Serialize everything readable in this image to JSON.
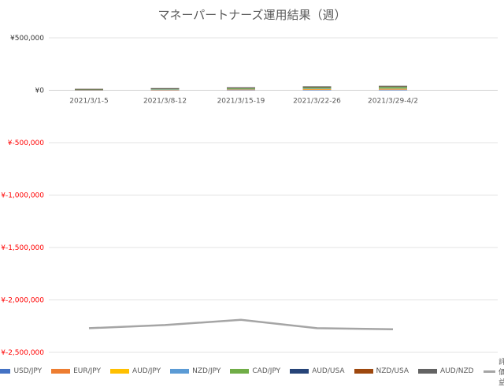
{
  "chart_data": {
    "type": "bar",
    "title": "マネーパートナーズ運用結果（週）",
    "categories": [
      "2021/3/1-5",
      "2021/3/8-12",
      "2021/3/15-19",
      "2021/3/22-26",
      "2021/3/29-4/2"
    ],
    "ylim": [
      -2500000,
      500000
    ],
    "yticks": [
      "¥500,000",
      "¥0",
      "¥-500,000",
      "¥-1,000,000",
      "¥-1,500,000",
      "¥-2,000,000",
      "¥-2,500,000"
    ],
    "ytick_values": [
      500000,
      0,
      -500000,
      -1000000,
      -1500000,
      -2000000,
      -2500000
    ],
    "stacked": true,
    "grid": true,
    "legend_position": "bottom",
    "series": [
      {
        "name": "USD/JPY",
        "color": "#4472c4",
        "values": [
          1500,
          3000,
          4000,
          5000,
          6000
        ]
      },
      {
        "name": "EUR/JPY",
        "color": "#ed7d31",
        "values": [
          1000,
          2000,
          2500,
          3500,
          4000
        ]
      },
      {
        "name": "AUD/JPY",
        "color": "#ffc000",
        "values": [
          2000,
          3000,
          4000,
          6000,
          7000
        ]
      },
      {
        "name": "NZD/JPY",
        "color": "#5b9bd5",
        "values": [
          1000,
          1500,
          2000,
          2500,
          3000
        ]
      },
      {
        "name": "CAD/JPY",
        "color": "#70ad47",
        "values": [
          4000,
          5000,
          7000,
          10000,
          12000
        ]
      },
      {
        "name": "AUD/USA",
        "color": "#264478",
        "values": [
          2000,
          3000,
          4000,
          5000,
          5000
        ]
      },
      {
        "name": "NZD/USA",
        "color": "#9e480e",
        "values": [
          1000,
          1500,
          2000,
          3000,
          3000
        ]
      },
      {
        "name": "AUD/NZD",
        "color": "#636363",
        "values": [
          1000,
          1500,
          2500,
          3000,
          3500
        ]
      }
    ],
    "line_series": {
      "name": "評価益",
      "color": "#a5a5a5",
      "values": [
        -2270000,
        -2240000,
        -2190000,
        -2270000,
        -2280000
      ]
    }
  }
}
